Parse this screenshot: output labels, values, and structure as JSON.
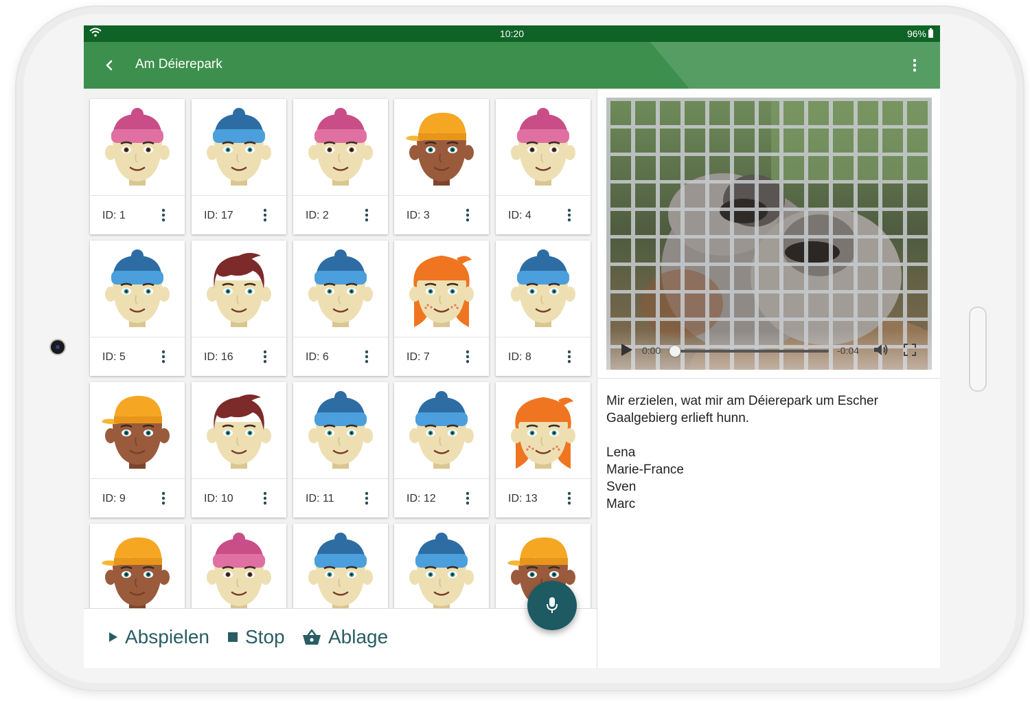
{
  "status_bar": {
    "time": "10:20",
    "battery": "96%"
  },
  "app_bar": {
    "title": "Am Déierepark"
  },
  "grid": {
    "cards": [
      {
        "id_label": "ID: 1",
        "avatar": "beanie-pink-light"
      },
      {
        "id_label": "ID: 17",
        "avatar": "beanie-blue-light"
      },
      {
        "id_label": "ID: 2",
        "avatar": "beanie-pink-light"
      },
      {
        "id_label": "ID: 3",
        "avatar": "cap-yellow-dark"
      },
      {
        "id_label": "ID: 4",
        "avatar": "beanie-pink-light"
      },
      {
        "id_label": "ID: 5",
        "avatar": "beanie-blue-light"
      },
      {
        "id_label": "ID: 16",
        "avatar": "hair-brown-light"
      },
      {
        "id_label": "ID: 6",
        "avatar": "beanie-blue-light"
      },
      {
        "id_label": "ID: 7",
        "avatar": "hair-orange-freckles"
      },
      {
        "id_label": "ID: 8",
        "avatar": "beanie-blue-light"
      },
      {
        "id_label": "ID: 9",
        "avatar": "cap-yellow-dark"
      },
      {
        "id_label": "ID: 10",
        "avatar": "hair-brown-light"
      },
      {
        "id_label": "ID: 11",
        "avatar": "beanie-blue-light"
      },
      {
        "id_label": "ID: 12",
        "avatar": "beanie-blue-light"
      },
      {
        "id_label": "ID: 13",
        "avatar": "hair-orange-freckles"
      },
      {
        "id_label": "",
        "avatar": "cap-yellow-dark"
      },
      {
        "id_label": "",
        "avatar": "beanie-pink-light"
      },
      {
        "id_label": "",
        "avatar": "beanie-blue-light"
      },
      {
        "id_label": "",
        "avatar": "beanie-blue-light"
      },
      {
        "id_label": "",
        "avatar": "cap-yellow-dark"
      }
    ]
  },
  "bottom_bar": {
    "play_label": "Abspielen",
    "stop_label": "Stop",
    "storage_label": "Ablage"
  },
  "video": {
    "current_time": "0:00",
    "remaining_time": "-0:04",
    "progress": 0
  },
  "description": {
    "text": "Mir erzielen, wat mir am Déierepark um Escher Gaalgebierg erlieft hunn.",
    "names": [
      "Lena",
      "Marie-France",
      "Sven",
      "Marc"
    ]
  },
  "colors": {
    "status_bar": "#0f6326",
    "app_bar": "#3d8f4d",
    "accent": "#1d5a62",
    "action_text": "#285d63"
  },
  "icons": {
    "back": "arrow-back-icon",
    "menu": "more-vert-icon",
    "play": "play-triangle-icon",
    "stop": "stop-square-icon",
    "storage": "basket-icon",
    "fab": "microphone-icon"
  }
}
